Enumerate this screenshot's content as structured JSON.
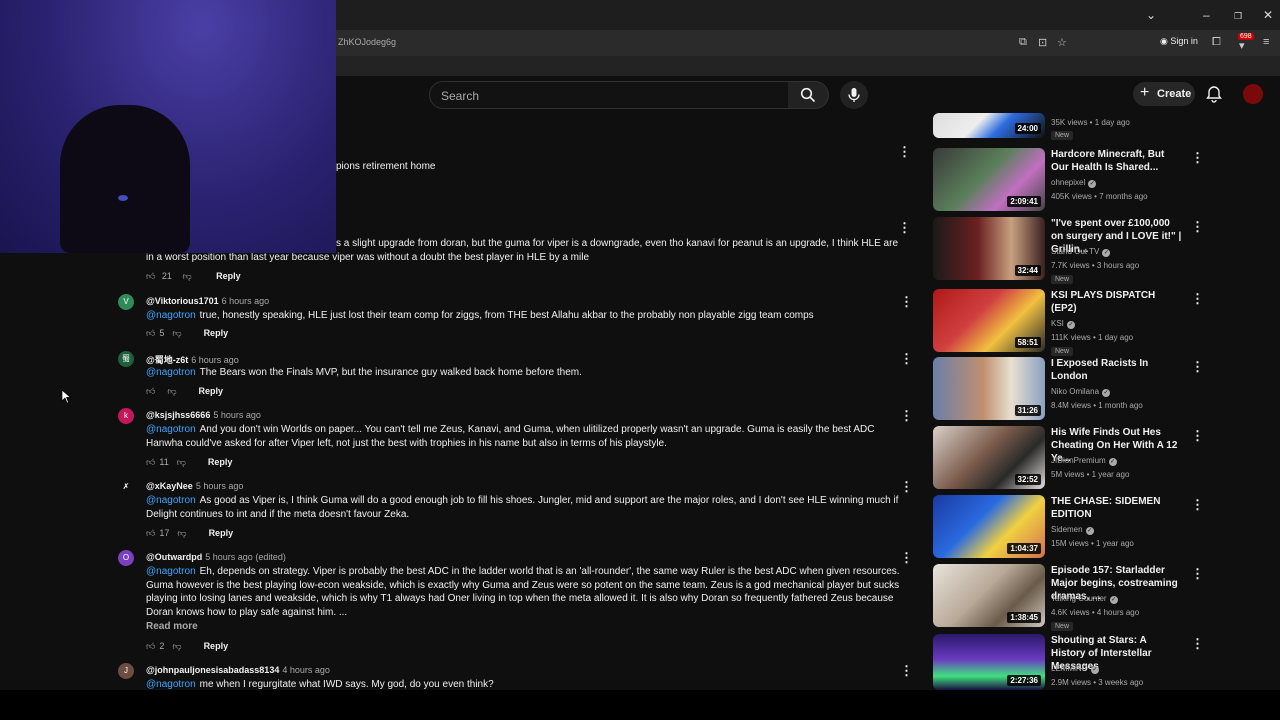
{
  "browser": {
    "url_fragment": "ZhKOJodeg6g",
    "sign_in": "Sign in",
    "badge": "698"
  },
  "header": {
    "search_placeholder": "Search",
    "create_label": "Create"
  },
  "partial": {
    "title_fragment": "pions retirement home",
    "first_comment_text": "s a slight upgrade from doran, but the guma for viper is a downgrade, even tho kanavi for peanut is an upgrade, I think HLE are in a worst position than last year because viper was without a doubt the best player in HLE by a mile",
    "first_comment_likes": "21"
  },
  "comments": [
    {
      "author": "@Viktorious1701",
      "time": "6 hours ago",
      "mention": "@nagotron",
      "text": "true, honestly speaking, HLE just lost their team comp for ziggs, from THE best Allahu akbar to the probably non playable zigg team comps",
      "likes": "5",
      "avatar_color": "#2e8b57",
      "avatar_letter": "V"
    },
    {
      "author": "@蜀地-z6t",
      "time": "6 hours ago",
      "mention": "@nagotron",
      "text": "The Bears won the Finals MVP, but the insurance guy walked back home before them.",
      "likes": "",
      "avatar_color": "#1f5f3a",
      "avatar_letter": "蜀"
    },
    {
      "author": "@ksjsjhss6666",
      "time": "5 hours ago",
      "mention": "@nagotron",
      "text": "And you don't win Worlds on paper... You can't tell me Zeus, Kanavi, and Guma, when ulitilized properly wasn't an upgrade. Guma is easily the best ADC Hanwha could've asked for after Viper left, not just the best with trophies in his name but also in terms of his playstyle.",
      "likes": "11",
      "avatar_color": "#c2185b",
      "avatar_letter": "k"
    },
    {
      "author": "@xKayNee",
      "time": "5 hours ago",
      "mention": "@nagotron",
      "text": "As good as Viper is, I think Guma will do a good enough job to fill his shoes. Jungler, mid and support are the major roles, and I don't see HLE winning much if Delight continues to int and if the meta doesn't favour Zeka.",
      "likes": "17",
      "avatar_color": "#0f0f0f",
      "avatar_letter": "✗"
    },
    {
      "author": "@Outwardpd",
      "time": "5 hours ago (edited)",
      "mention": "@nagotron",
      "text": "Eh, depends on strategy. Viper is probably the best ADC in the ladder world that is an 'all-rounder', the same way Ruler is the best ADC when given resources. Guma however is the best playing low-econ weakside, which is exactly why Guma and Zeus were so potent on the same team. Zeus is a god mechanical player but sucks playing into losing lanes and weakside, which is why T1 always had Oner living in top when the meta allowed it. It is also why Doran so frequently fathered Zeus because Doran knows how to play safe against him. ...",
      "likes": "2",
      "avatar_color": "#7b3fbf",
      "avatar_letter": "O",
      "read_more": "Read more"
    },
    {
      "author": "@johnpauljonesisabadass8134",
      "time": "4 hours ago",
      "mention": "@nagotron",
      "text": "me when I regurgitate what IWD says. My god, do you even think?",
      "likes": "",
      "avatar_color": "#6d4c41",
      "avatar_letter": "J"
    }
  ],
  "reply_label": "Reply",
  "sidebar": [
    {
      "title": "",
      "channel": "",
      "meta": "35K views • 1 day ago",
      "new": "New",
      "duration": "24:00",
      "thumb": "linear-gradient(135deg,#ddd 0%,#eee 40%,#2d6cdf 60%,#111 100%)"
    },
    {
      "title": "Hardcore Minecraft, But Our Health Is Shared...",
      "channel": "ohnepixel",
      "meta": "405K views • 7 months ago",
      "new": "",
      "duration": "2:09:41",
      "thumb": "linear-gradient(135deg,#3a3a3a 0%,#5a7f5a 45%,#c070c0 70%,#444 100%)"
    },
    {
      "title": "\"I've spent over £100,000 on surgery and I LOVE it!\" | Grillin...",
      "channel": "Stand Out TV",
      "meta": "7.7K views • 3 hours ago",
      "new": "New",
      "duration": "32:44",
      "thumb": "linear-gradient(90deg,#1a1a1a 0%,#6b2020 40%,#c8a080 70%,#3a2020 100%)"
    },
    {
      "title": "KSI PLAYS DISPATCH (EP2)",
      "channel": "KSI",
      "meta": "111K views • 1 day ago",
      "new": "New",
      "duration": "58:51",
      "thumb": "linear-gradient(135deg,#b01818 0%,#d04040 40%,#f0c040 65%,#2a2a2a 100%)"
    },
    {
      "title": "I Exposed Racists In London",
      "channel": "Niko Omilana",
      "meta": "8.4M views • 1 month ago",
      "new": "",
      "duration": "31:26",
      "thumb": "linear-gradient(90deg,#6a7fa8 0%,#c09070 45%,#e8e0d0 70%,#8aa0c0 100%)"
    },
    {
      "title": "His Wife Finds Out Hes Cheating On Her With A 12 Ye...",
      "channel": "JIDionPremium",
      "meta": "5M views • 1 year ago",
      "new": "",
      "duration": "32:52",
      "thumb": "linear-gradient(135deg,#d8d0c8 0%,#7a5a4a 45%,#2a2a2a 70%,#e8e0e0 100%)"
    },
    {
      "title": "THE CHASE: SIDEMEN EDITION",
      "channel": "Sidemen",
      "meta": "15M views • 1 year ago",
      "new": "",
      "duration": "1:04:37",
      "thumb": "linear-gradient(135deg,#1a3aa0 0%,#2a6ae0 40%,#f0d040 65%,#d07050 100%)"
    },
    {
      "title": "Episode 157: Starladder Major begins, costreaming dramas, ...",
      "channel": "Talking Counter",
      "meta": "4.6K views • 4 hours ago",
      "new": "New",
      "duration": "1:38:45",
      "thumb": "linear-gradient(135deg,#e8e4dc 0%,#b8a898 45%,#6a5a4a 70%,#d0c8c0 100%)"
    },
    {
      "title": "Shouting at Stars: A History of Interstellar Messages",
      "channel": "LEMMiNO",
      "meta": "2.9M views • 3 weeks ago",
      "new": "",
      "duration": "2:27:36",
      "thumb": "linear-gradient(180deg,#2a1a6a 0%,#6a3ac0 45%,#40e080 75%,#1a1040 100%)"
    }
  ]
}
